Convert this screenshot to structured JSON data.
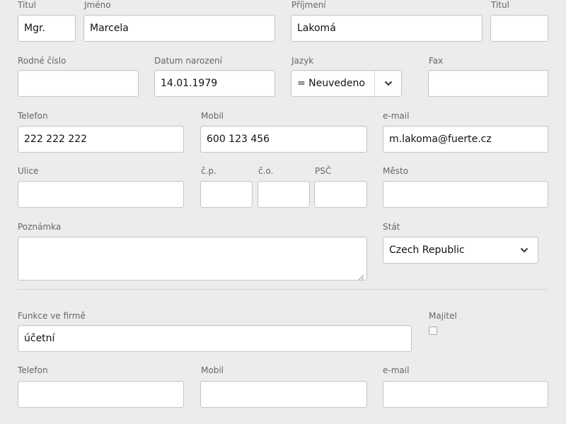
{
  "person": {
    "title_before": {
      "label": "Titul",
      "value": "Mgr."
    },
    "first_name": {
      "label": "Jméno",
      "value": "Marcela"
    },
    "last_name": {
      "label": "Příjmení",
      "value": "Lakomá"
    },
    "title_after": {
      "label": "Titul",
      "value": ""
    },
    "birth_number": {
      "label": "Rodné číslo",
      "value": ""
    },
    "birth_date": {
      "label": "Datum narození",
      "value": "14.01.1979"
    },
    "language": {
      "label": "Jazyk",
      "value": "= Neuvedeno"
    },
    "fax": {
      "label": "Fax",
      "value": ""
    },
    "phone": {
      "label": "Telefon",
      "value": "222 222 222"
    },
    "mobile": {
      "label": "Mobil",
      "value": "600 123 456"
    },
    "email": {
      "label": "e-mail",
      "value": "m.lakoma@fuerte.cz"
    },
    "street": {
      "label": "Ulice",
      "value": ""
    },
    "cp": {
      "label": "č.p.",
      "value": ""
    },
    "co": {
      "label": "č.o.",
      "value": ""
    },
    "zip": {
      "label": "PSČ",
      "value": ""
    },
    "city": {
      "label": "Město",
      "value": ""
    },
    "note": {
      "label": "Poznámka",
      "value": ""
    },
    "country": {
      "label": "Stát",
      "value": "Czech Republic"
    }
  },
  "company": {
    "position": {
      "label": "Funkce ve firmě",
      "value": "účetní"
    },
    "owner": {
      "label": "Majitel",
      "checked": false
    },
    "phone": {
      "label": "Telefon",
      "value": ""
    },
    "mobile": {
      "label": "Mobil",
      "value": ""
    },
    "email": {
      "label": "e-mail",
      "value": ""
    }
  }
}
